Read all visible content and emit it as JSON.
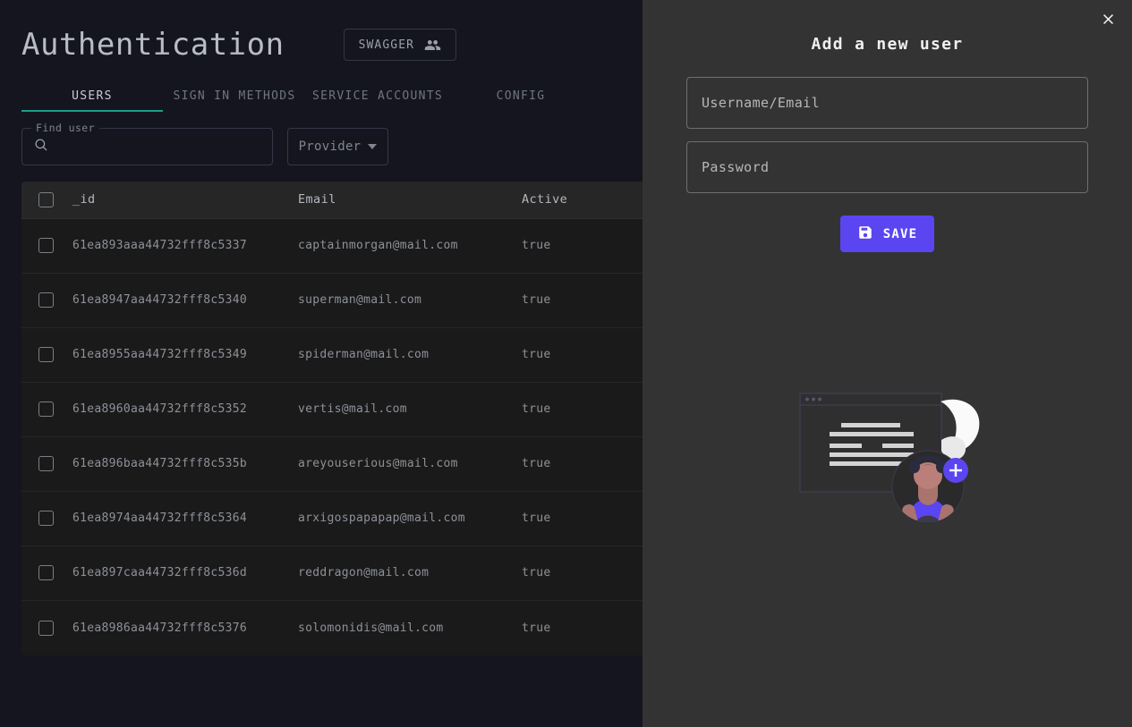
{
  "page": {
    "title": "Authentication",
    "swagger_button": "SWAGGER",
    "swagger_icon": "people-group-icon"
  },
  "tabs": [
    {
      "label": "USERS",
      "active": true
    },
    {
      "label": "SIGN IN METHODS",
      "active": false
    },
    {
      "label": "SERVICE ACCOUNTS",
      "active": false
    },
    {
      "label": "CONFIG",
      "active": false
    }
  ],
  "filters": {
    "find_user_label": "Find user",
    "find_user_value": "",
    "find_user_placeholder": "",
    "search_icon": "search-icon",
    "provider_label": "Provider",
    "provider_caret_icon": "chevron-down-icon"
  },
  "table": {
    "columns": [
      "_id",
      "Email",
      "Active"
    ],
    "rows": [
      {
        "id": "61ea893aaa44732fff8c5337",
        "email": "captainmorgan@mail.com",
        "active": "true"
      },
      {
        "id": "61ea8947aa44732fff8c5340",
        "email": "superman@mail.com",
        "active": "true"
      },
      {
        "id": "61ea8955aa44732fff8c5349",
        "email": "spiderman@mail.com",
        "active": "true"
      },
      {
        "id": "61ea8960aa44732fff8c5352",
        "email": "vertis@mail.com",
        "active": "true"
      },
      {
        "id": "61ea896baa44732fff8c535b",
        "email": "areyouserious@mail.com",
        "active": "true"
      },
      {
        "id": "61ea8974aa44732fff8c5364",
        "email": "arxigospapapap@mail.com",
        "active": "true"
      },
      {
        "id": "61ea897caa44732fff8c536d",
        "email": "reddragon@mail.com",
        "active": "true"
      },
      {
        "id": "61ea8986aa44732fff8c5376",
        "email": "solomonidis@mail.com",
        "active": "true"
      }
    ]
  },
  "panel": {
    "title": "Add a new user",
    "close_icon": "close-icon",
    "username_value": "",
    "username_placeholder": "Username/Email",
    "password_value": "",
    "password_placeholder": "Password",
    "save_label": "SAVE",
    "save_icon": "save-floppy-icon",
    "illustration": "add-user-illustration"
  },
  "colors": {
    "background": "#14151f",
    "panel_background": "#333333",
    "table_row": "#1a1a1a",
    "table_header": "#262626",
    "accent_tab_underline": "#1b9e8a",
    "accent_primary": "#5b45f0"
  }
}
